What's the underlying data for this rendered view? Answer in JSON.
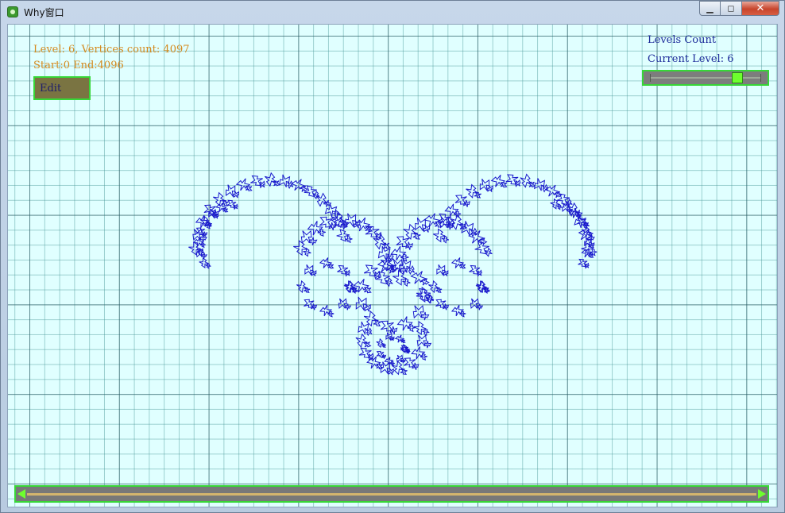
{
  "window": {
    "title": "Why窗口",
    "icon": "leaf-app-icon",
    "controls": {
      "minimize": "▁",
      "maximize": "◻",
      "close": "✕"
    }
  },
  "info": {
    "line1": "Level: 6, Vertices count: 4097",
    "line2": "Start:0 End:4096"
  },
  "edit_button": {
    "label": "Edit"
  },
  "levels_panel": {
    "title": "Levels Count",
    "current": "Current Level: 6",
    "slider_fraction": 0.82
  },
  "scrollbar": {
    "position_fraction": 0.0
  },
  "colors": {
    "background": "#e0ffff",
    "fractal_stroke": "#1a1acc",
    "info_text": "#d48a1e",
    "accent_green": "#37d637"
  }
}
